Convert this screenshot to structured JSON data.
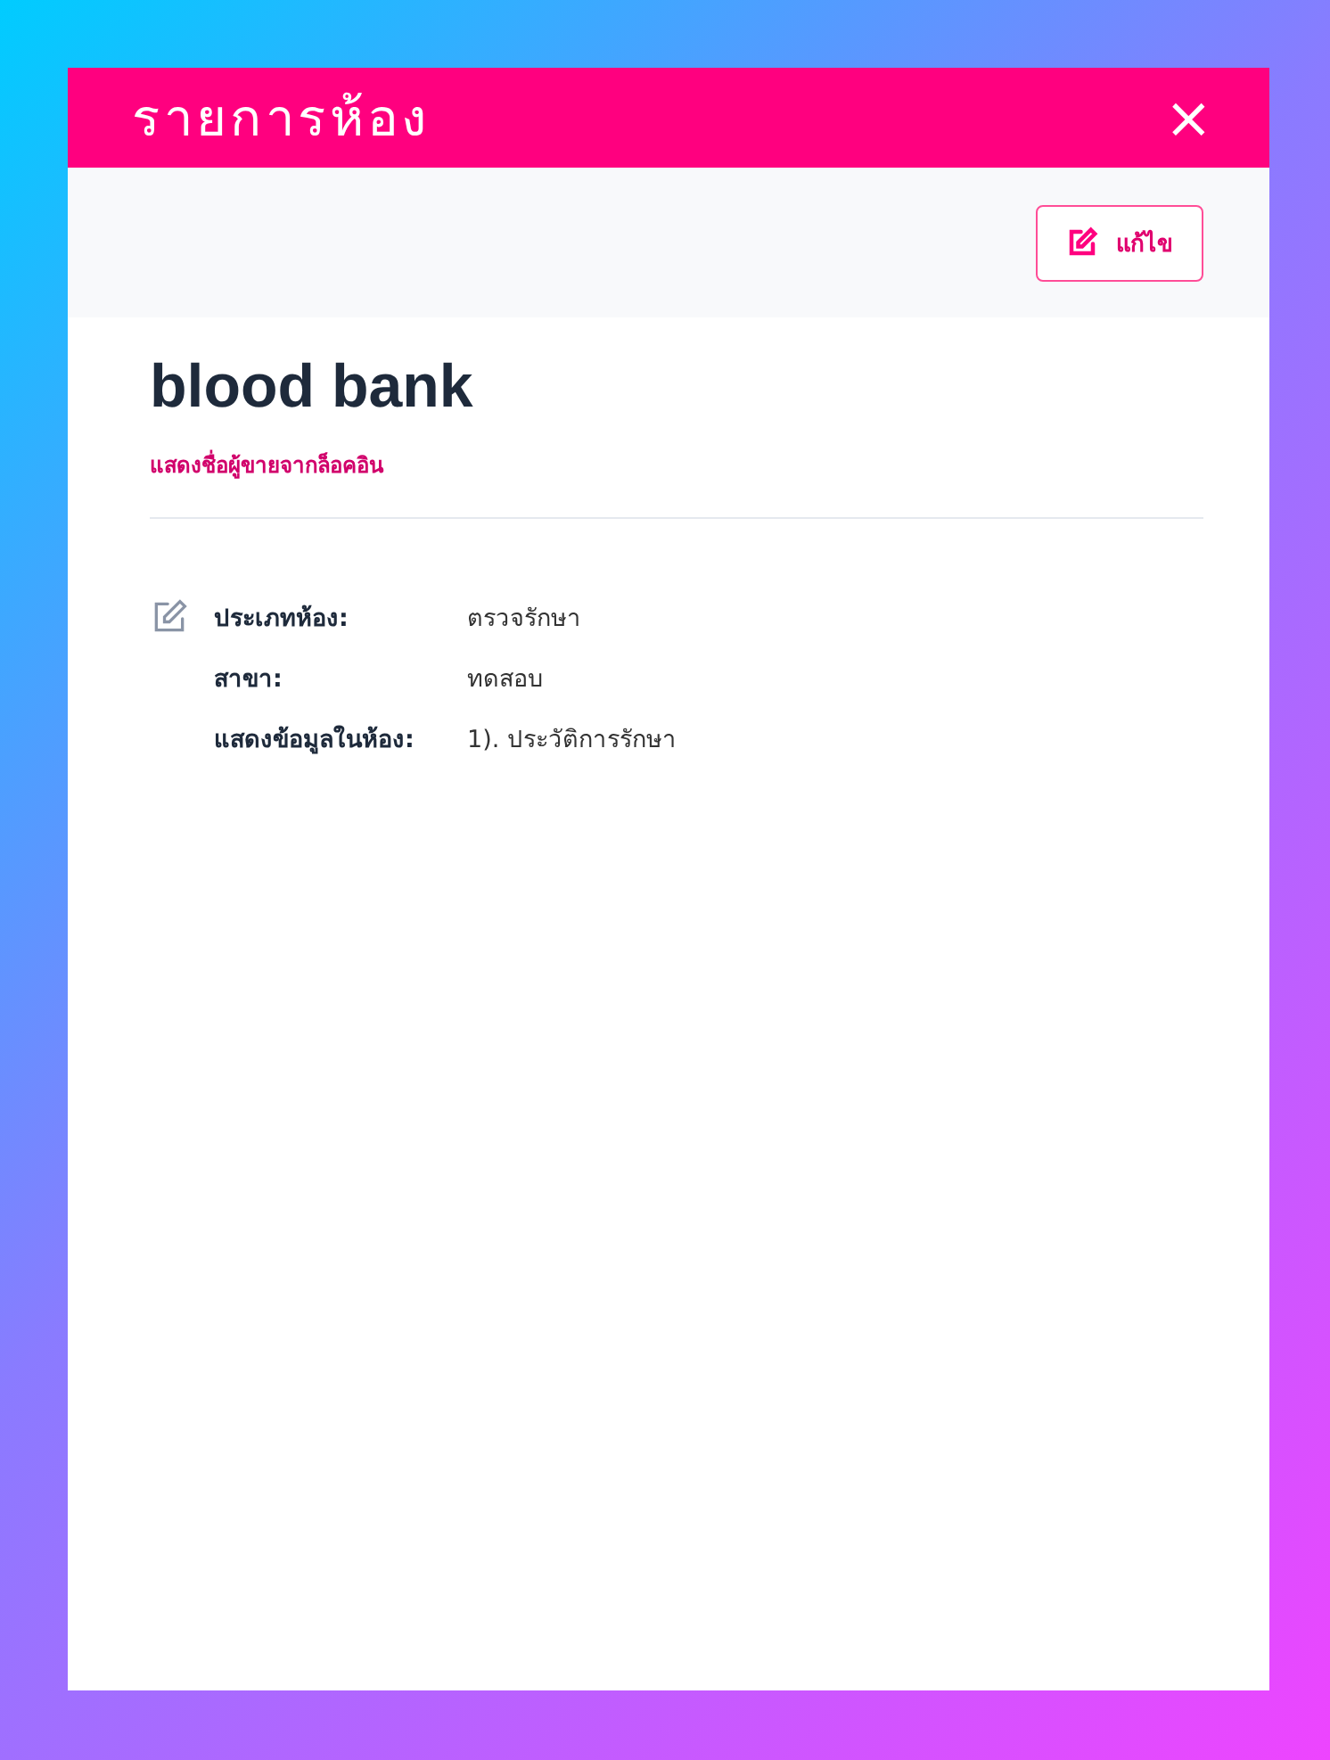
{
  "modal": {
    "title": "รายการห้อง",
    "close": "×"
  },
  "toolbar": {
    "edit_button": "แก้ไข"
  },
  "room": {
    "name": "blood bank",
    "subtitle": "แสดงชื่อผู้ขายจากล็อคอิน",
    "details": [
      {
        "label": "ประเภทห้อง:",
        "value": "ตรวจรักษา"
      },
      {
        "label": "สาขา:",
        "value": "ทดสอบ"
      },
      {
        "label": "แสดงข้อมูลในห้อง:",
        "value": "1). ประวัติการรักษา"
      }
    ]
  }
}
